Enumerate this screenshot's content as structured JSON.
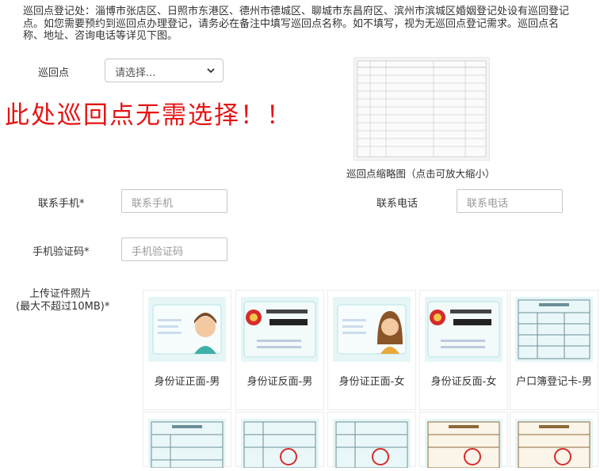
{
  "notice": "巡回点登记处：淄博市张店区、日照市东港区、德州市德城区、聊城市东昌府区、滨州市滨城区婚姻登记处设有巡回登记点。如您需要预约到巡回点办理登记，请务必在备注中填写巡回点名称。如不填写，视为无巡回点登记需求。巡回点名称、地址、咨询电话等详见下图。",
  "tour_point": {
    "label": "巡回点",
    "select_value": "请选择..."
  },
  "warning": "此处巡回点无需选择！！",
  "thumbnail": {
    "caption": "巡回点缩略图（点击可放大缩小）"
  },
  "mobile": {
    "label": "联系手机*",
    "placeholder": "联系手机"
  },
  "phone": {
    "label": "联系电话",
    "placeholder": "联系电话"
  },
  "sms_code": {
    "label": "手机验证码*",
    "placeholder": "手机验证码"
  },
  "upload": {
    "label_line1": "上传证件照片",
    "label_line2": "(最大不超过10MB)*"
  },
  "samples": [
    {
      "caption": "身份证正面-男",
      "icon": "id-card-front-male-icon"
    },
    {
      "caption": "身份证反面-男",
      "icon": "id-card-back-icon"
    },
    {
      "caption": "身份证正面-女",
      "icon": "id-card-front-female-icon"
    },
    {
      "caption": "身份证反面-女",
      "icon": "id-card-back-icon"
    },
    {
      "caption": "户口簿登记卡-男",
      "icon": "household-register-icon"
    }
  ],
  "colors": {
    "warning": "#e41515",
    "card_bg": "#e6f6f7"
  }
}
